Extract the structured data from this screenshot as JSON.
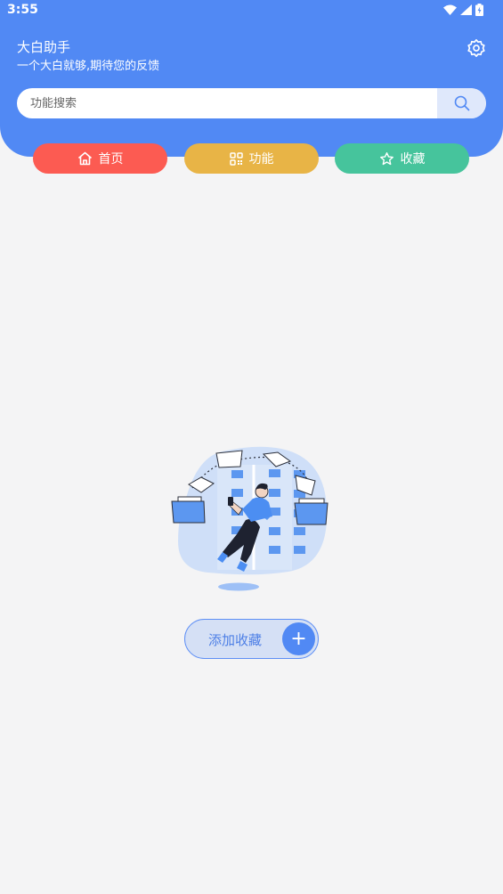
{
  "status_bar": {
    "time": "3:55"
  },
  "header": {
    "title": "大白助手",
    "subtitle": "一个大白就够,期待您的反馈",
    "settings_icon": "gear-icon"
  },
  "search": {
    "placeholder": "功能搜索",
    "value": ""
  },
  "tabs": [
    {
      "label": "首页",
      "icon": "home-icon",
      "color": "#fc5b52"
    },
    {
      "label": "功能",
      "icon": "grid-icon",
      "color": "#e8b446"
    },
    {
      "label": "收藏",
      "icon": "star-icon",
      "color": "#46c49c"
    }
  ],
  "empty_state": {
    "add_favorite_label": "添加收藏"
  },
  "colors": {
    "primary": "#5189f4",
    "background": "#f4f4f5"
  }
}
